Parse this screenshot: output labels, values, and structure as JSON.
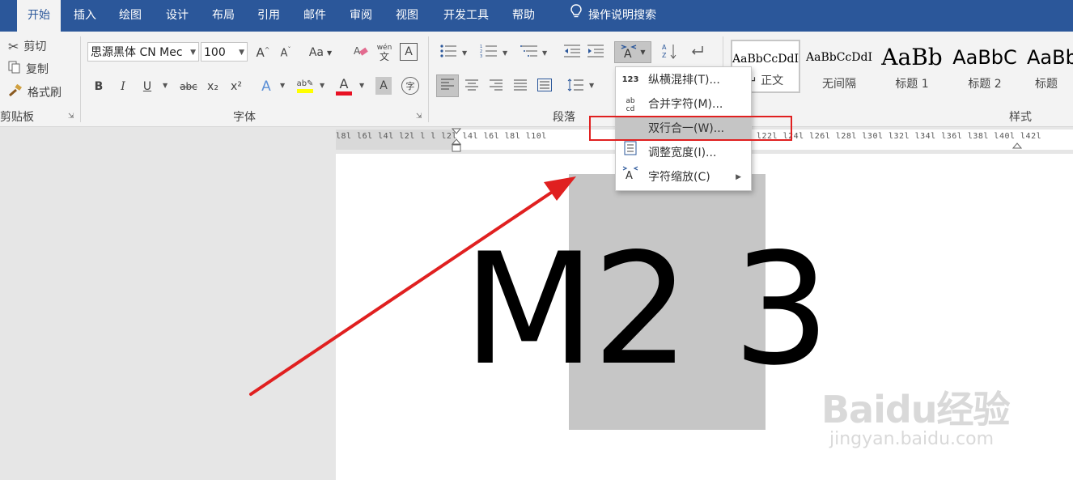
{
  "tabs": [
    {
      "label": "开始",
      "active": true
    },
    {
      "label": "插入"
    },
    {
      "label": "绘图"
    },
    {
      "label": "设计"
    },
    {
      "label": "布局"
    },
    {
      "label": "引用"
    },
    {
      "label": "邮件"
    },
    {
      "label": "审阅"
    },
    {
      "label": "视图"
    },
    {
      "label": "开发工具"
    },
    {
      "label": "帮助"
    }
  ],
  "tell_me": "操作说明搜索",
  "clipboard": {
    "cut": "剪切",
    "copy": "复制",
    "format_painter": "格式刷",
    "group_label": "剪贴板"
  },
  "font": {
    "family": "思源黑体 CN Mec",
    "size": "100",
    "group_label": "字体",
    "aa_label": "Aa",
    "bold": "B",
    "italic": "I",
    "underline": "U",
    "strike": "abc",
    "subscript": "x₂",
    "superscript": "x²",
    "phonetic_top": "wén",
    "phonetic_bottom": "文",
    "font_color": "A",
    "char_shade": "A",
    "enclose": "字"
  },
  "paragraph": {
    "group_label": "段落"
  },
  "styles": {
    "group_label": "样式",
    "items": [
      {
        "preview": "AaBbCcDdI",
        "name": "正文"
      },
      {
        "preview": "AaBbCcDdI",
        "name": "无间隔"
      },
      {
        "preview": "AaBb",
        "name": "标题 1"
      },
      {
        "preview": "AaBbC",
        "name": "标题 2"
      },
      {
        "preview": "AaBb",
        "name": "标题"
      }
    ]
  },
  "ruler_text": "l8l  l6l  l4l  l2l  l   l  l2l  l4l  l6l  l8l  l10l",
  "ruler_text_right": "l22l  l24l  l26l  l28l  l30l  l32l  l34l  l36l  l38l  l40l  l42l",
  "document": {
    "text": "M2 3"
  },
  "menu": {
    "items": [
      {
        "icon": "123",
        "label": "纵横混排(T)..."
      },
      {
        "icon": "ab cd",
        "label": "合并字符(M)..."
      },
      {
        "icon": "",
        "label": "双行合一(W)...",
        "highlighted": true
      },
      {
        "icon": "▤",
        "label": "调整宽度(I)..."
      },
      {
        "icon": "A",
        "label": "字符缩放(C)",
        "submenu": true
      }
    ]
  },
  "watermark": {
    "logo": "Baidu经验",
    "url": "jingyan.baidu.com"
  },
  "colors": {
    "accent": "#2b579a",
    "highlight_bar": "#ffff00",
    "font_color_bar": "#e81123",
    "annotation": "#e02020"
  }
}
